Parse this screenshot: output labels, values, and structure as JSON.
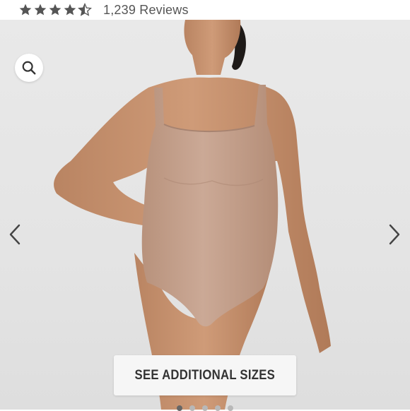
{
  "rating": {
    "stars": 4.5,
    "count_label": "1,239 Reviews",
    "star_color": "#555555"
  },
  "gallery": {
    "search_icon": "search-icon",
    "prev_icon": "chevron-left-icon",
    "next_icon": "chevron-right-icon",
    "current_index": 0,
    "total_images": 5,
    "product_color": "#c8a48f"
  },
  "cta": {
    "label": "SEE ADDITIONAL SIZES"
  }
}
